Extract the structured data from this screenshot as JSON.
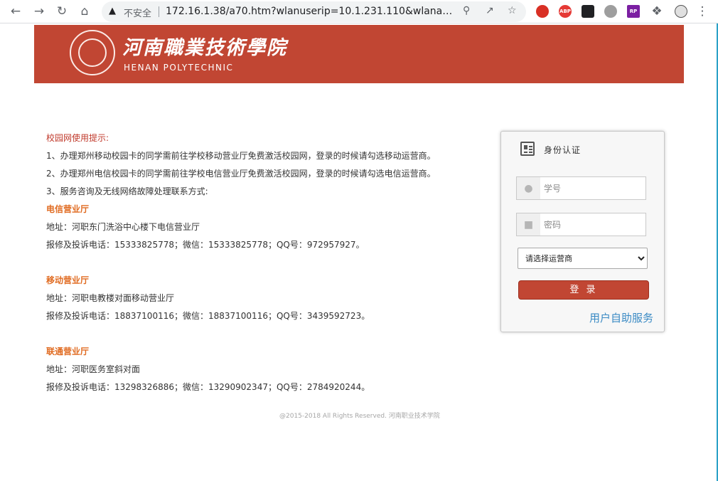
{
  "browser": {
    "insecure_label": "不安全",
    "url": "172.16.1.38/a70.htm?wlanuserip=10.1.231.110&wlanacip=...",
    "extensions": [
      "ABP",
      "RP"
    ]
  },
  "banner": {
    "name_cn": "河南職業技術學院",
    "name_en": "HENAN POLYTECHNIC",
    "brand_color": "#c14633"
  },
  "notice": {
    "heading": "校园网使用提示:",
    "items": [
      "1、办理郑州移动校园卡的同学需前往学校移动营业厅免费激活校园网，登录的时候请勾选移动运营商。",
      "2、办理郑州电信校园卡的同学需前往学校电信营业厅免费激活校园网，登录的时候请勾选电信运营商。",
      "3、服务咨询及无线网络故障处理联系方式:"
    ],
    "halls": [
      {
        "name": "电信营业厅",
        "address": "地址：河职东门洗浴中心楼下电信营业厅",
        "contact": "报修及投诉电话：15333825778；微信：15333825778；QQ号：972957927。"
      },
      {
        "name": "移动营业厅",
        "address": "地址：河职电教楼对面移动营业厅",
        "contact": "报修及投诉电话：18837100116；微信：18837100116；QQ号：3439592723。"
      },
      {
        "name": "联通营业厅",
        "address": "地址：河职医务室斜对面",
        "contact": "报修及投诉电话：13298326886；微信：13290902347；QQ号：2784920244。"
      }
    ]
  },
  "copyright": "@2015-2018  All Rights Reserved.   河南职业技术学院",
  "login": {
    "title": "身份认证",
    "username_placeholder": "学号",
    "password_placeholder": "密码",
    "carrier_selected": "请选择运营商",
    "submit_label": "登 录",
    "self_service_link": "用户自助服务"
  }
}
